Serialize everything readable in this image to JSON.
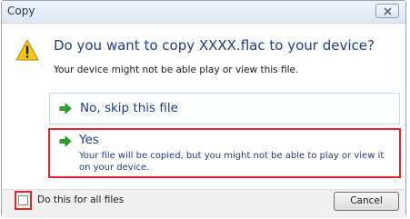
{
  "window": {
    "title": "Copy"
  },
  "dialog": {
    "heading": "Do you want to copy XXXX.flac to your device?",
    "subtext": "Your device might not be able play or view this file."
  },
  "options": {
    "skip": {
      "label": "No, skip this file",
      "icon": "green-arrow-icon"
    },
    "yes": {
      "label": "Yes",
      "description": "Your file will be copied, but you might not be able to play or view it on your device.",
      "icon": "green-arrow-icon"
    }
  },
  "footer": {
    "checkbox_label": "Do this for all files",
    "checkbox_checked": false,
    "cancel_label": "Cancel"
  },
  "colors": {
    "accent_text": "#1a3f8c",
    "highlight_border": "#e0252f",
    "arrow_green": "#2fa32f",
    "warning_yellow": "#f5c518"
  }
}
